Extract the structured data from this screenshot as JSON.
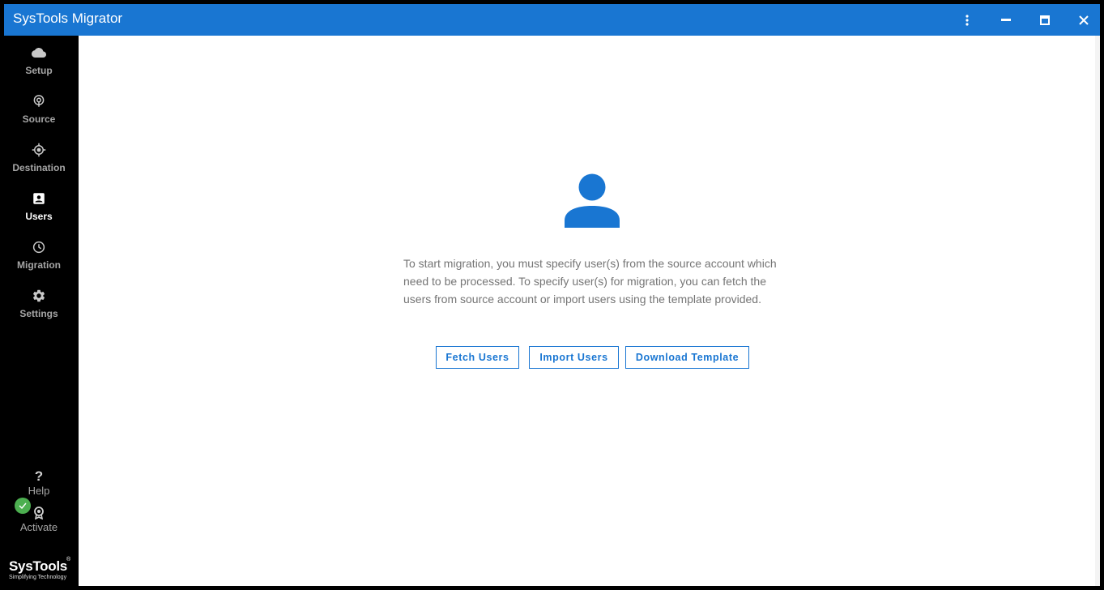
{
  "window": {
    "title": "SysTools Migrator",
    "controls": [
      "more-vert-icon",
      "minimize-icon",
      "maximize-icon",
      "close-icon"
    ]
  },
  "sidebar": {
    "items": [
      {
        "label": "Setup",
        "icon": "cloud-icon",
        "active": false
      },
      {
        "label": "Source",
        "icon": "source-icon",
        "active": false
      },
      {
        "label": "Destination",
        "icon": "target-icon",
        "active": false
      },
      {
        "label": "Users",
        "icon": "account-box-icon",
        "active": true
      },
      {
        "label": "Migration",
        "icon": "history-icon",
        "active": false
      },
      {
        "label": "Settings",
        "icon": "gear-icon",
        "active": false
      }
    ],
    "help": {
      "symbol": "?",
      "label": "Help"
    },
    "activate": {
      "label": "Activate",
      "icon": "badge-icon",
      "status": "activated"
    },
    "brand": {
      "name": "SysTools",
      "reg": "®",
      "tagline": "Simplifying Technology"
    }
  },
  "main": {
    "illustration": "user-icon",
    "message": "To start migration, you must specify user(s) from the source account which need to be processed. To specify user(s) for migration, you can fetch the users from source account or import users using the template provided.",
    "buttons": {
      "fetch": "Fetch Users",
      "import": "Import Users",
      "download": "Download Template"
    }
  },
  "colors": {
    "accent": "#1976d2",
    "sidebar_bg": "#000000",
    "success": "#4caf50",
    "text_muted": "#757575"
  }
}
